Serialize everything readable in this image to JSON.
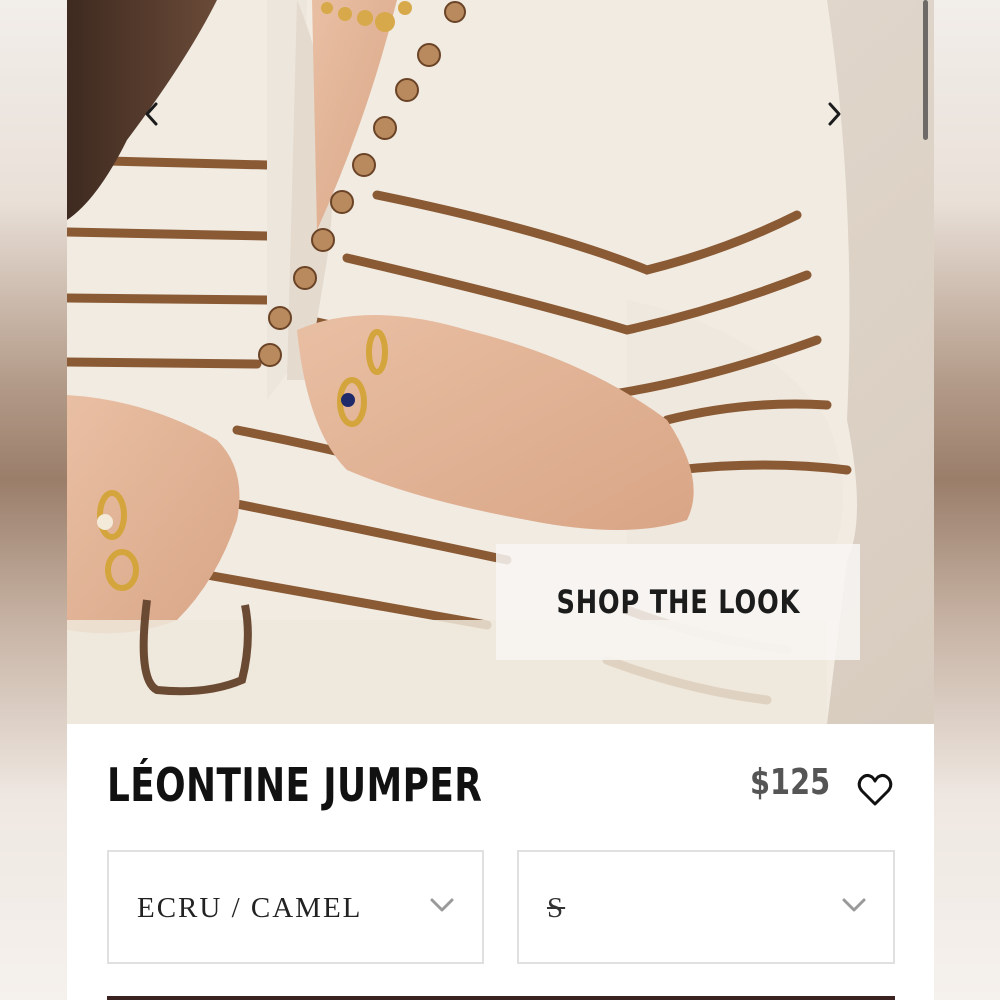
{
  "hero": {
    "shop_the_look_label": "SHOP THE LOOK",
    "prev_icon": "chevron-left-icon",
    "next_icon": "chevron-right-icon"
  },
  "product": {
    "title": "LÉONTINE JUMPER",
    "price": "$125",
    "wishlist_icon": "heart-outline-icon"
  },
  "options": {
    "color": {
      "value": "ECRU / CAMEL",
      "icon": "chevron-down-icon"
    },
    "size": {
      "value": "S",
      "icon": "chevron-down-icon",
      "unavailable": true
    }
  },
  "colors": {
    "sweater": "#f1ebe2",
    "stripe": "#8a5a34",
    "text_dark": "#111111",
    "price_gray": "#555555",
    "button_bar": "#3a2220"
  }
}
